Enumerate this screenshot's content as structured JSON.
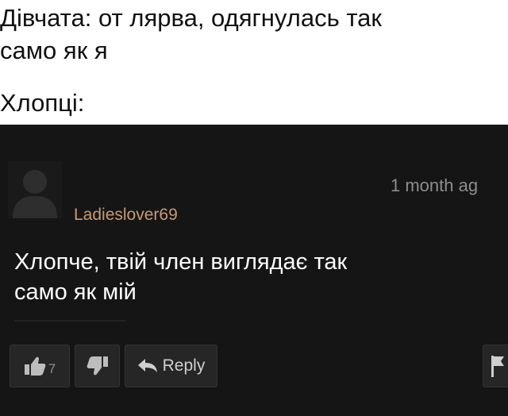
{
  "caption": {
    "girls_line_1": "Дівчата: от лярва, одягнулась так",
    "girls_line_2": "само як я",
    "boys": "Хлопці:"
  },
  "comment": {
    "timestamp": "1 month ag",
    "username": "Ladieslover69",
    "text_line_1": "Хлопче, твій член виглядає так",
    "text_line_2": "само як мій",
    "like_count": "7",
    "reply_label": "Reply"
  },
  "icons": {
    "avatar": "default-avatar-icon",
    "like": "thumbs-up-icon",
    "dislike": "thumbs-down-icon",
    "reply": "reply-arrow-icon",
    "flag": "flag-icon"
  },
  "colors": {
    "panel_background": "#151515",
    "username": "#c79a76",
    "timestamp": "#8d8d8d",
    "comment_text": "#ffffff",
    "button_background": "#262626"
  }
}
